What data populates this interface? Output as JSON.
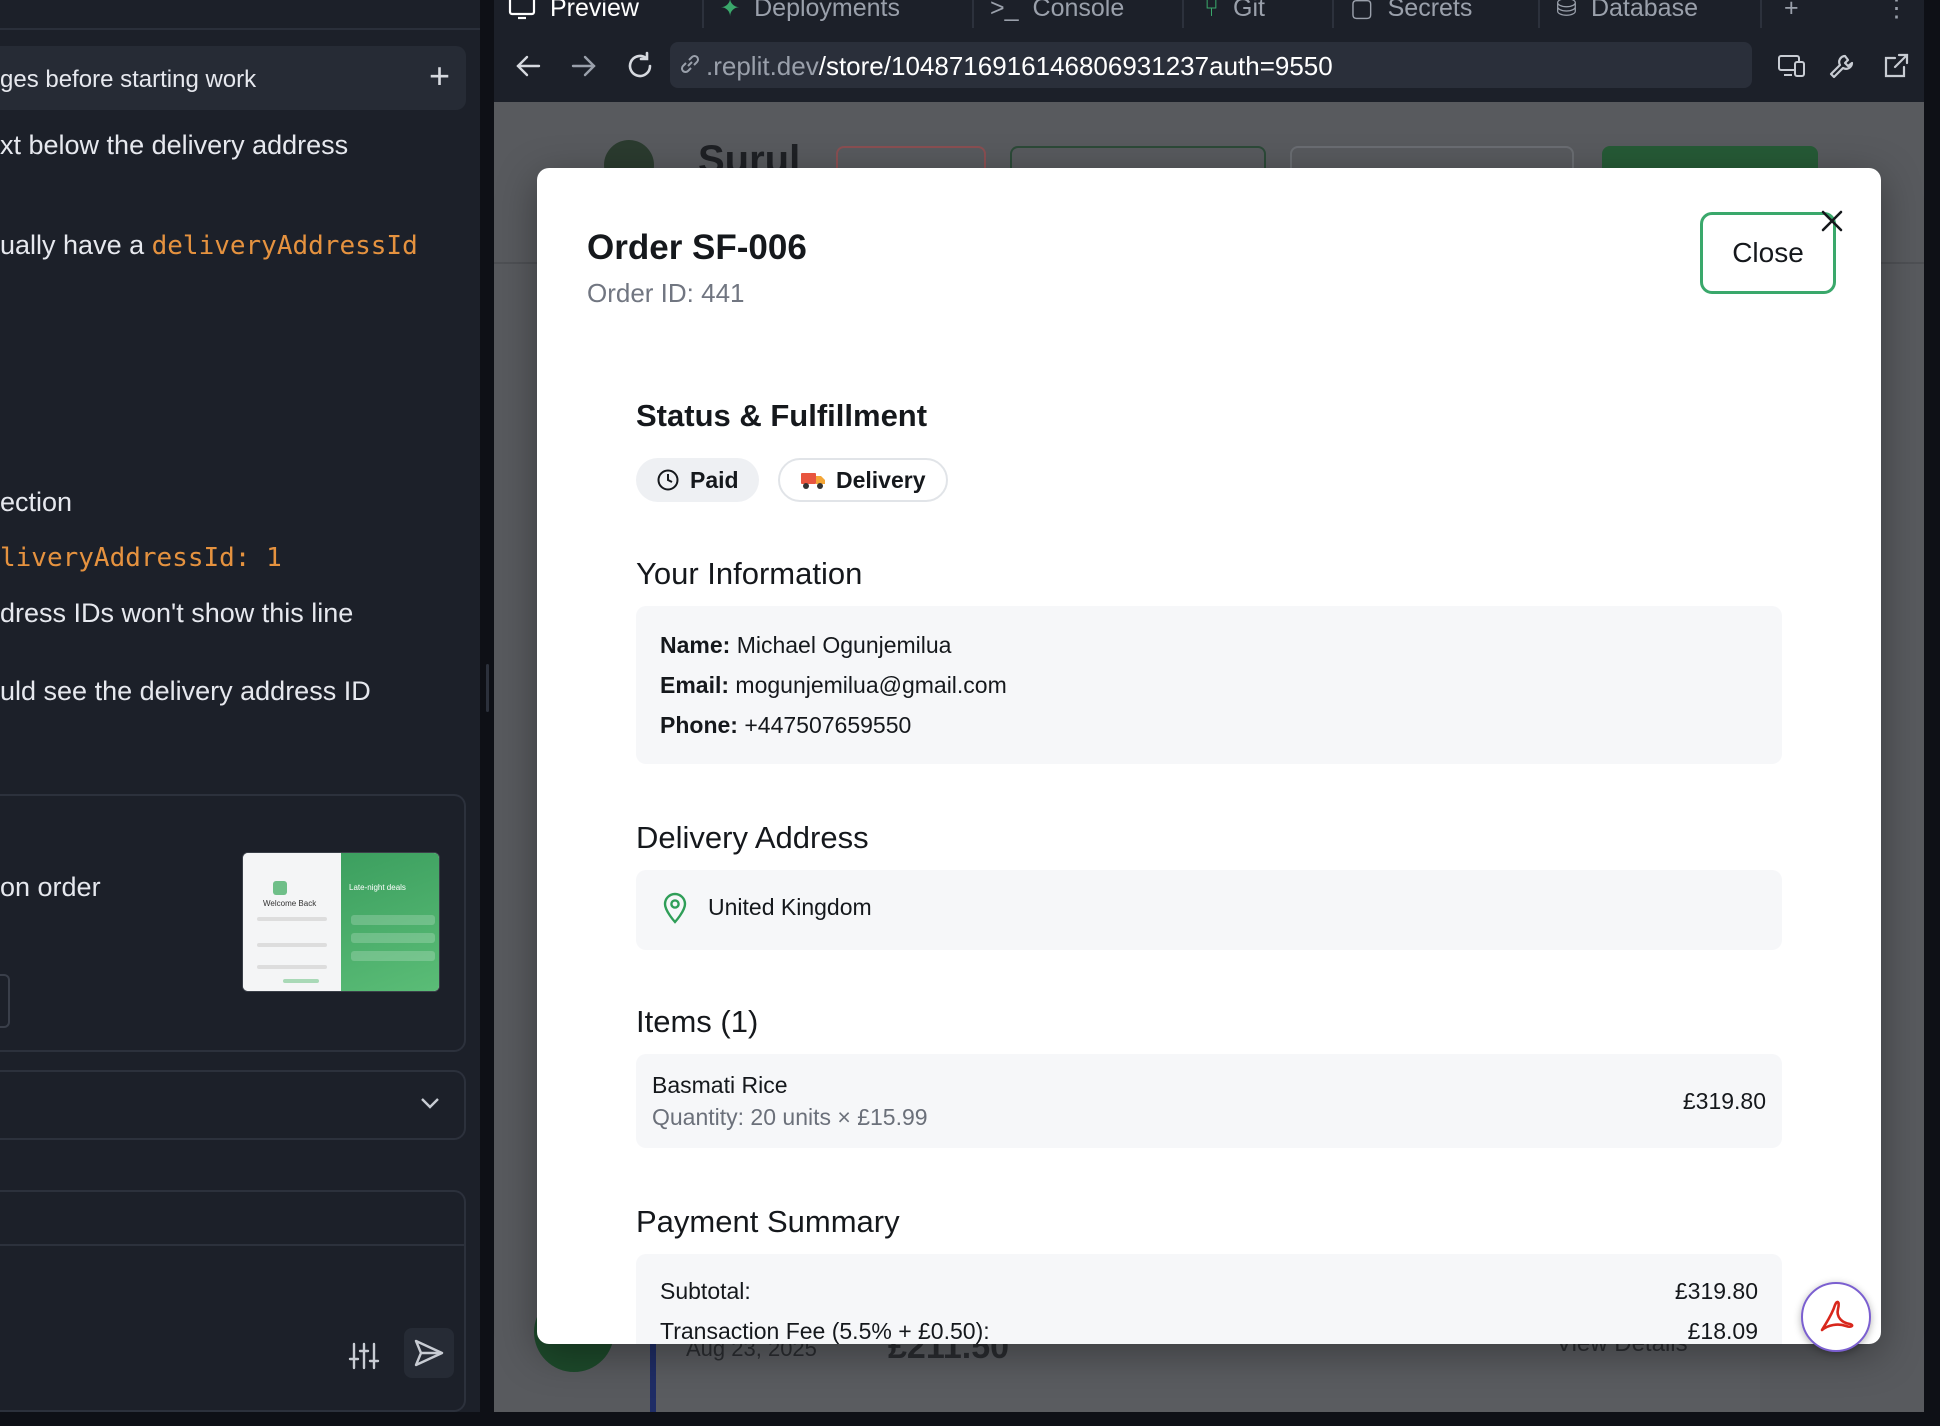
{
  "chat": {
    "top_bar_text": "ges before starting work",
    "lines": {
      "l1": "xt below the delivery address",
      "l2_prefix": "ually have a ",
      "l2_code": "deliveryAddressId",
      "l3": "ection",
      "l4_code": "liveryAddressId: 1",
      "l5": "dress IDs won't show this line",
      "l6": "uld see the delivery address ID"
    },
    "card_text": "on order",
    "thumbnail": {
      "left_heading": "Welcome Back",
      "right_heading": "Late-night deals"
    }
  },
  "browser": {
    "tabs": [
      "Preview",
      "Deployments",
      "Console",
      "Git",
      "Secrets",
      "Database"
    ],
    "url_domain": ".replit.dev",
    "url_path": "/store/1048716916146806931237auth=9550"
  },
  "background_page": {
    "store_name": "Surul",
    "order_date": "Aug 23, 2025",
    "order_amount": "£211.50",
    "view_details_label": "View Details"
  },
  "modal": {
    "title": "Order SF-006",
    "order_id_label": "Order ID: 441",
    "close_label": "Close",
    "sections": {
      "status_title": "Status & Fulfillment",
      "info_title": "Your Information",
      "address_title": "Delivery Address",
      "items_title": "Items (1)",
      "payment_title": "Payment Summary"
    },
    "status_pills": {
      "payment_status": "Paid",
      "fulfillment": "Delivery"
    },
    "customer": {
      "name_label": "Name:",
      "name_value": "Michael Ogunjemilua",
      "email_label": "Email:",
      "email_value": "mogunjemilua@gmail.com",
      "phone_label": "Phone:",
      "phone_value": "+447507659550"
    },
    "address": "United Kingdom",
    "items": [
      {
        "name": "Basmati Rice",
        "quantity": "Quantity: 20 units × £15.99",
        "total": "£319.80"
      }
    ],
    "payment": {
      "subtotal_label": "Subtotal:",
      "subtotal_value": "£319.80",
      "fee_label": "Transaction Fee (5.5% + £0.50):",
      "fee_value": "£18.09"
    }
  },
  "colors": {
    "accent_green": "#3aa86b",
    "code_orange": "#e5923f",
    "pin_green": "#2f9e58"
  }
}
